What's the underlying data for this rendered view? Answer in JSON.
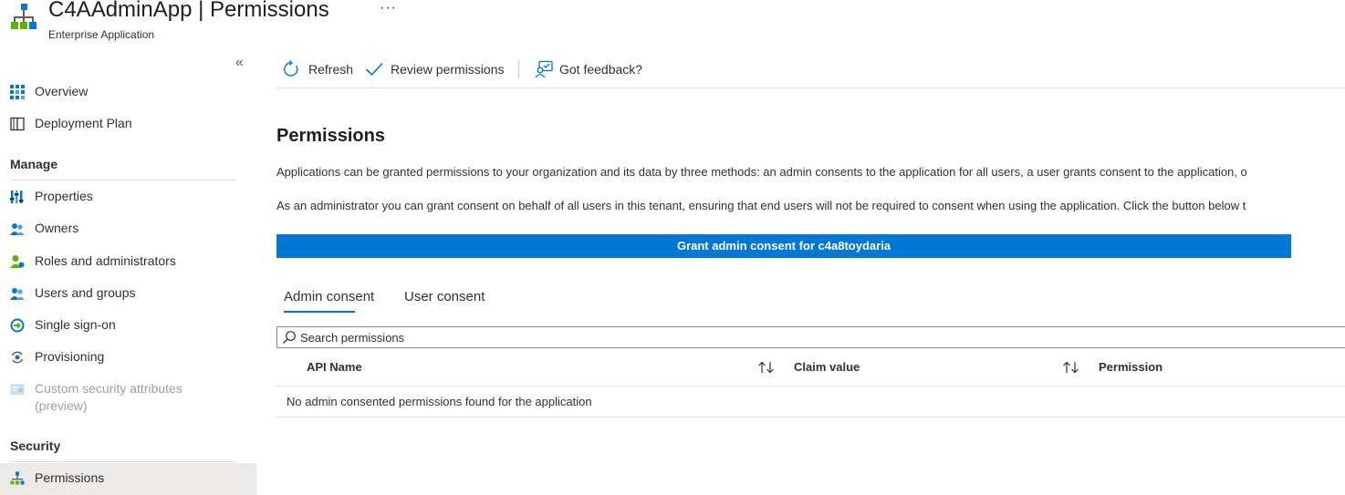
{
  "header": {
    "title": "C4AAdminApp | Permissions",
    "subtitle": "Enterprise Application",
    "more": "···",
    "app_icon": "app-hierarchy-icon"
  },
  "sidebar": {
    "collapse": "«",
    "items": [
      {
        "label": "Overview",
        "icon": "overview-icon"
      },
      {
        "label": "Deployment Plan",
        "icon": "book-icon"
      }
    ],
    "manage": {
      "header": "Manage",
      "items": [
        {
          "label": "Properties",
          "icon": "properties-icon"
        },
        {
          "label": "Owners",
          "icon": "owners-icon"
        },
        {
          "label": "Roles and administrators",
          "icon": "roles-icon"
        },
        {
          "label": "Users and groups",
          "icon": "users-icon"
        },
        {
          "label": "Single sign-on",
          "icon": "sso-icon"
        },
        {
          "label": "Provisioning",
          "icon": "provisioning-icon"
        },
        {
          "label": "Custom security attributes",
          "label2": "(preview)",
          "icon": "custom-attributes-icon",
          "disabled": true
        }
      ]
    },
    "security": {
      "header": "Security",
      "items": [
        {
          "label": "Permissions",
          "icon": "permissions-icon",
          "selected": true
        }
      ]
    }
  },
  "toolbar": {
    "refresh": "Refresh",
    "review": "Review permissions",
    "feedback": "Got feedback?"
  },
  "main": {
    "heading": "Permissions",
    "para1": "Applications can be granted permissions to your organization and its data by three methods: an admin consents to the application for all users, a user grants consent to the application, o",
    "para2": "As an administrator you can grant consent on behalf of all users in this tenant, ensuring that end users will not be required to consent when using the application. Click the button below t",
    "grant_button": "Grant admin consent for c4a8toydaria",
    "tabs": [
      {
        "label": "Admin consent",
        "active": true
      },
      {
        "label": "User consent",
        "active": false
      }
    ],
    "search_placeholder": "Search permissions",
    "columns": [
      "API Name",
      "Claim value",
      "Permission"
    ],
    "empty_message": "No admin consented permissions found for the application"
  },
  "colors": {
    "accent": "#0078d4",
    "selected_bg": "#edebe9",
    "border": "#e1dfdd"
  }
}
